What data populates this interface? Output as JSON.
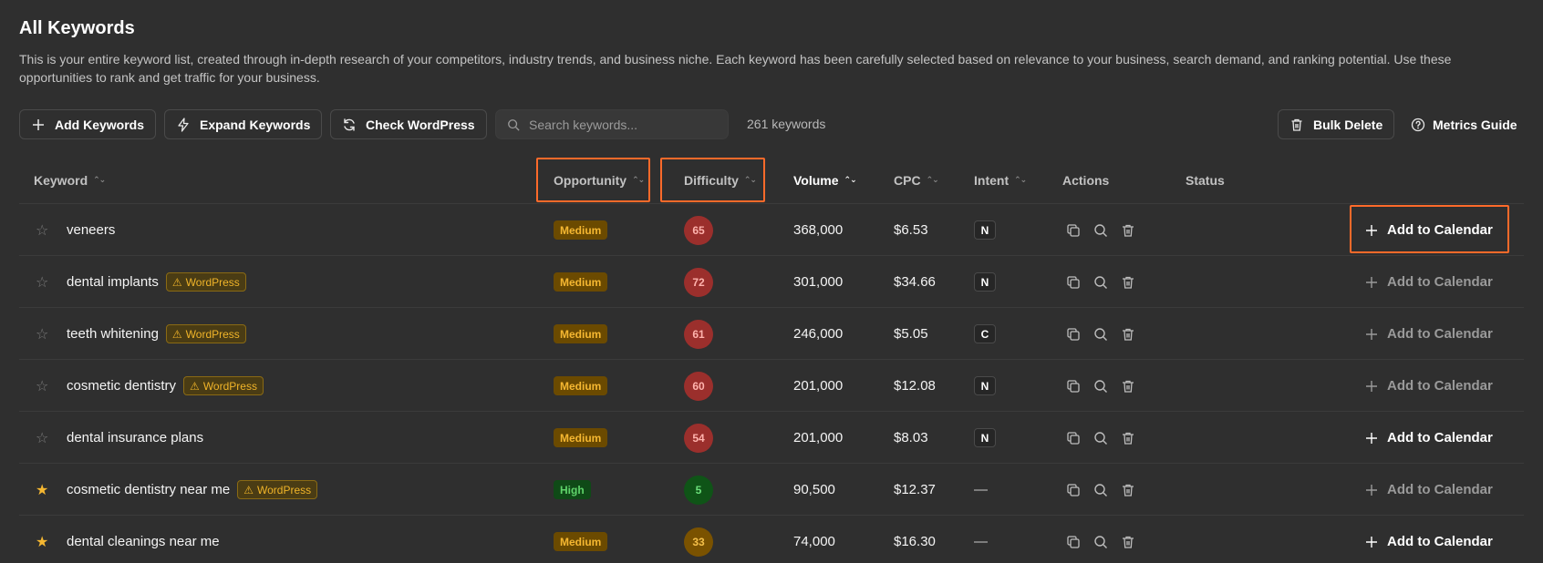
{
  "header": {
    "title": "All Keywords",
    "description": "This is your entire keyword list, created through in-depth research of your competitors, industry trends, and business niche. Each keyword has been carefully selected based on relevance to your business, search demand, and ranking potential. Use these opportunities to rank and get traffic for your business."
  },
  "toolbar": {
    "add_keywords": "Add Keywords",
    "expand_keywords": "Expand Keywords",
    "check_wordpress": "Check WordPress",
    "search_placeholder": "Search keywords...",
    "keyword_count": "261 keywords",
    "bulk_delete": "Bulk Delete",
    "metrics_guide": "Metrics Guide"
  },
  "table": {
    "columns": {
      "keyword": "Keyword",
      "opportunity": "Opportunity",
      "difficulty": "Difficulty",
      "volume": "Volume",
      "cpc": "CPC",
      "intent": "Intent",
      "actions": "Actions",
      "status": "Status"
    },
    "add_to_calendar": "Add to Calendar",
    "wordpress_badge": "WordPress",
    "rows": [
      {
        "keyword": "veneers",
        "starred": false,
        "wordpress": false,
        "opportunity": "Medium",
        "difficulty": "65",
        "volume": "368,000",
        "cpc": "$6.53",
        "intent": "N",
        "calendar_active": true
      },
      {
        "keyword": "dental implants",
        "starred": false,
        "wordpress": true,
        "opportunity": "Medium",
        "difficulty": "72",
        "volume": "301,000",
        "cpc": "$34.66",
        "intent": "N",
        "calendar_active": false
      },
      {
        "keyword": "teeth whitening",
        "starred": false,
        "wordpress": true,
        "opportunity": "Medium",
        "difficulty": "61",
        "volume": "246,000",
        "cpc": "$5.05",
        "intent": "C",
        "calendar_active": false
      },
      {
        "keyword": "cosmetic dentistry",
        "starred": false,
        "wordpress": true,
        "opportunity": "Medium",
        "difficulty": "60",
        "volume": "201,000",
        "cpc": "$12.08",
        "intent": "N",
        "calendar_active": false
      },
      {
        "keyword": "dental insurance plans",
        "starred": false,
        "wordpress": false,
        "opportunity": "Medium",
        "difficulty": "54",
        "volume": "201,000",
        "cpc": "$8.03",
        "intent": "N",
        "calendar_active": true
      },
      {
        "keyword": "cosmetic dentistry near me",
        "starred": true,
        "wordpress": true,
        "opportunity": "High",
        "difficulty": "5",
        "volume": "90,500",
        "cpc": "$12.37",
        "intent": "—",
        "calendar_active": false
      },
      {
        "keyword": "dental cleanings near me",
        "starred": true,
        "wordpress": false,
        "opportunity": "Medium",
        "difficulty": "33",
        "volume": "74,000",
        "cpc": "$16.30",
        "intent": "—",
        "calendar_active": true
      }
    ]
  },
  "colors": {
    "background": "#2f2f2f",
    "highlight": "#ff6a2a",
    "medium_badge_bg": "#6b4a00",
    "medium_badge_text": "#f5b731",
    "high_badge_bg": "#0f4a17",
    "high_badge_text": "#5fd36a",
    "difficulty_hard": "#9b2f2c",
    "difficulty_easy": "#0f5417",
    "difficulty_mid": "#7a5200",
    "star_on": "#f5b731"
  }
}
